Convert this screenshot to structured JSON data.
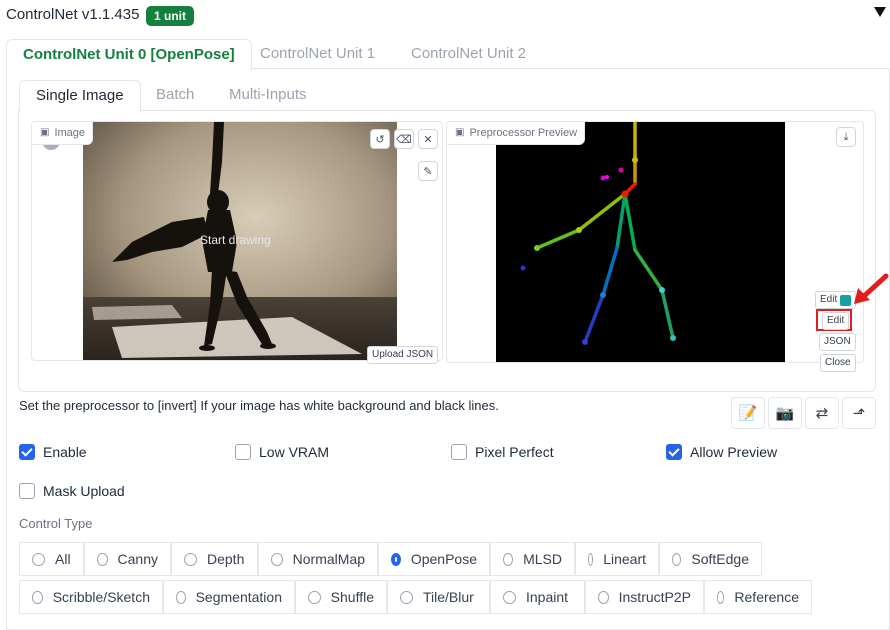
{
  "header": {
    "title": "ControlNet v1.1.435",
    "badge": "1 unit"
  },
  "unit_tabs": [
    {
      "label": "ControlNet Unit 0 [OpenPose]",
      "active": true
    },
    {
      "label": "ControlNet Unit 1",
      "active": false
    },
    {
      "label": "ControlNet Unit 2",
      "active": false
    }
  ],
  "input_tabs": [
    {
      "label": "Single Image",
      "active": true
    },
    {
      "label": "Batch",
      "active": false
    },
    {
      "label": "Multi-Inputs",
      "active": false
    }
  ],
  "image_panel": {
    "label": "Image",
    "overlay_text": "Start drawing",
    "upload_json": "Upload JSON"
  },
  "preview_panel": {
    "label": "Preprocessor Preview",
    "buttons": {
      "edit_photopea": "Edit",
      "edit": "Edit",
      "json": "JSON",
      "close": "Close"
    }
  },
  "hint": "Set the preprocessor to [invert] If your image has white background and black lines.",
  "tool_icons": [
    "edit-sketch-icon",
    "camera-icon",
    "swap-icon",
    "send-icon"
  ],
  "options": {
    "enable": {
      "label": "Enable",
      "checked": true
    },
    "low_vram": {
      "label": "Low VRAM",
      "checked": false
    },
    "pixel_perfect": {
      "label": "Pixel Perfect",
      "checked": false
    },
    "allow_preview": {
      "label": "Allow Preview",
      "checked": true
    },
    "mask_upload": {
      "label": "Mask Upload",
      "checked": false
    }
  },
  "control_type": {
    "label": "Control Type",
    "row1": [
      "All",
      "Canny",
      "Depth",
      "NormalMap",
      "OpenPose",
      "MLSD",
      "Lineart",
      "SoftEdge"
    ],
    "row2": [
      "Scribble/Sketch",
      "Segmentation",
      "Shuffle",
      "Tile/Blur",
      "Inpaint",
      "InstructP2P",
      "Reference"
    ],
    "selected": "OpenPose"
  },
  "colors": {
    "accent": "#15803d",
    "checkbox": "#2563eb",
    "highlight": "#e11d1d"
  }
}
